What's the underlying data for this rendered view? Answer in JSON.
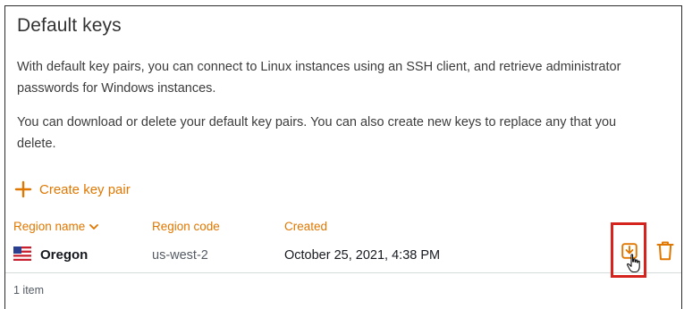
{
  "panel": {
    "title": "Default keys",
    "description_1": "With default key pairs, you can connect to Linux instances using an SSH client, and retrieve administrator passwords for Windows instances.",
    "description_2": "You can download or delete your default key pairs. You can also create new keys to replace any that you delete."
  },
  "actions": {
    "create_key_pair": "Create key pair"
  },
  "table": {
    "columns": {
      "region_name": "Region name",
      "region_code": "Region code",
      "created": "Created"
    },
    "rows": [
      {
        "region_name": "Oregon",
        "region_code": "us-west-2",
        "created": "October 25, 2021, 4:38 PM",
        "flag": "us-flag-icon"
      }
    ],
    "item_count": "1 item"
  },
  "icons": {
    "create": "plus-icon",
    "sort": "chevron-down-icon",
    "download": "download-icon",
    "delete": "trash-icon",
    "pointer": "hand-cursor-icon"
  },
  "colors": {
    "accent": "#e07700",
    "highlight": "#d5231e",
    "text_primary": "#16191f",
    "text_secondary": "#545b64"
  }
}
